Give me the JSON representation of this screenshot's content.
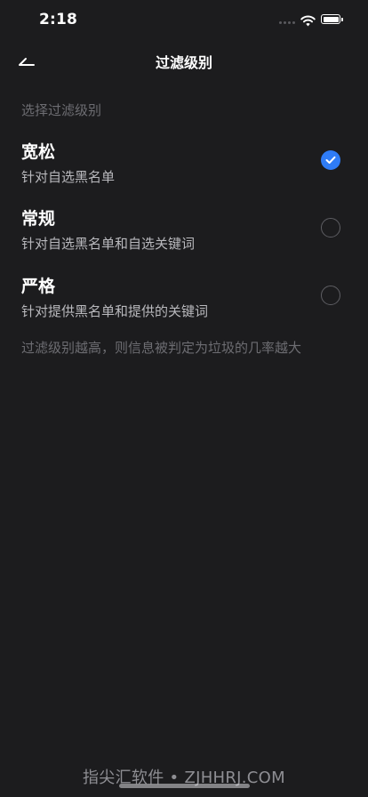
{
  "status_bar": {
    "time": "2:18"
  },
  "nav": {
    "title": "过滤级别"
  },
  "section_header": "选择过滤级别",
  "options": [
    {
      "title": "宽松",
      "description": "针对自选黑名单",
      "selected": true
    },
    {
      "title": "常规",
      "description": "针对自选黑名单和自选关键词",
      "selected": false
    },
    {
      "title": "严格",
      "description": "针对提供黑名单和提供的关键词",
      "selected": false
    }
  ],
  "footer_note": "过滤级别越高，则信息被判定为垃圾的几率越大",
  "watermark": "指尖汇软件 • ZJHHRJ.COM",
  "colors": {
    "background": "#1c1c1e",
    "accent": "#2f7cf6",
    "secondary_text": "#6d6d72"
  }
}
